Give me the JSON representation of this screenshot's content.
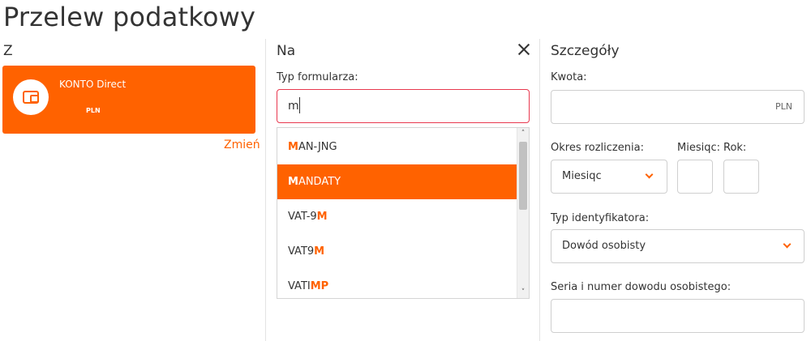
{
  "page": {
    "title": "Przelew podatkowy"
  },
  "from": {
    "heading": "Z",
    "account": {
      "name": "KONTO Direct",
      "currency": "PLN",
      "icon": "wallet-icon"
    },
    "change_label": "Zmień"
  },
  "to": {
    "heading": "Na",
    "form_type": {
      "label": "Typ formularza:",
      "value": "m",
      "options": [
        {
          "pre": "",
          "match": "M",
          "post": "AN-JNG"
        },
        {
          "pre": "",
          "match": "M",
          "post": "ANDATY"
        },
        {
          "pre": "VAT-9",
          "match": "M",
          "post": ""
        },
        {
          "pre": "VAT9",
          "match": "M",
          "post": ""
        },
        {
          "pre": "VATI",
          "match": "MP",
          "post": ""
        }
      ],
      "highlighted_index": 1
    }
  },
  "details": {
    "heading": "Szczegóły",
    "amount": {
      "label": "Kwota:",
      "currency": "PLN"
    },
    "period": {
      "label": "Okres rozliczenia:",
      "value": "Miesiqc"
    },
    "month": {
      "label": "Miesiqc:"
    },
    "year": {
      "label": "Rok:"
    },
    "identifier_type": {
      "label": "Typ identyfikatora:",
      "value": "Dowód osobisty"
    },
    "id_number": {
      "label": "Seria i numer dowodu osobistego:"
    }
  },
  "colors": {
    "accent": "#ff6200",
    "error_border": "#e8384f"
  }
}
